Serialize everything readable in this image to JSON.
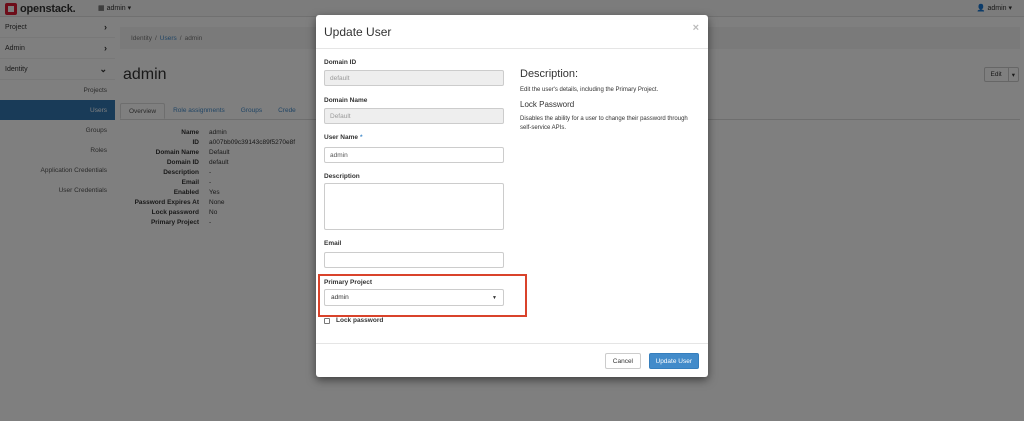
{
  "topbar": {
    "brand": "openstack.",
    "project_dropdown": "admin",
    "user_dropdown": "admin"
  },
  "sidebar": {
    "sections": [
      {
        "label": "Project"
      },
      {
        "label": "Admin"
      },
      {
        "label": "Identity"
      }
    ],
    "identity_items": [
      {
        "label": "Projects"
      },
      {
        "label": "Users"
      },
      {
        "label": "Groups"
      },
      {
        "label": "Roles"
      },
      {
        "label": "Application Credentials"
      },
      {
        "label": "User Credentials"
      }
    ]
  },
  "breadcrumb": {
    "items": [
      "Identity",
      "Users",
      "admin"
    ]
  },
  "page": {
    "title": "admin",
    "edit_label": "Edit"
  },
  "tabs": [
    {
      "label": "Overview"
    },
    {
      "label": "Role assignments"
    },
    {
      "label": "Groups"
    },
    {
      "label": "Crede"
    }
  ],
  "details": [
    {
      "key": "Name",
      "value": "admin"
    },
    {
      "key": "ID",
      "value": "a007bb09c39143c89f5270e8f"
    },
    {
      "key": "Domain Name",
      "value": "Default"
    },
    {
      "key": "Domain ID",
      "value": "default"
    },
    {
      "key": "Description",
      "value": "-"
    },
    {
      "key": "Email",
      "value": "-"
    },
    {
      "key": "Enabled",
      "value": "Yes"
    },
    {
      "key": "Password Expires At",
      "value": "None"
    },
    {
      "key": "Lock password",
      "value": "No"
    },
    {
      "key": "Primary Project",
      "value": "-"
    }
  ],
  "modal": {
    "title": "Update User",
    "close_glyph": "×",
    "fields": {
      "domain_id": {
        "label": "Domain ID",
        "value": "default"
      },
      "domain_name": {
        "label": "Domain Name",
        "value": "Default"
      },
      "user_name": {
        "label": "User Name",
        "required_mark": "*",
        "value": "admin"
      },
      "description": {
        "label": "Description",
        "value": ""
      },
      "email": {
        "label": "Email",
        "value": ""
      },
      "primary_project": {
        "label": "Primary Project",
        "value": "admin"
      },
      "lock_password": {
        "label": "Lock password",
        "checked": false
      }
    },
    "help": {
      "desc_title": "Description:",
      "desc_text": "Edit the user's details, including the Primary Project.",
      "lock_title": "Lock Password",
      "lock_text": "Disables the ability for a user to change their password through self-service APIs."
    },
    "cancel_label": "Cancel",
    "submit_label": "Update User"
  },
  "colors": {
    "accent": "#428bca",
    "sidebar_active": "#3276b1",
    "highlight": "#d9432b",
    "brand": "#da1a32"
  }
}
